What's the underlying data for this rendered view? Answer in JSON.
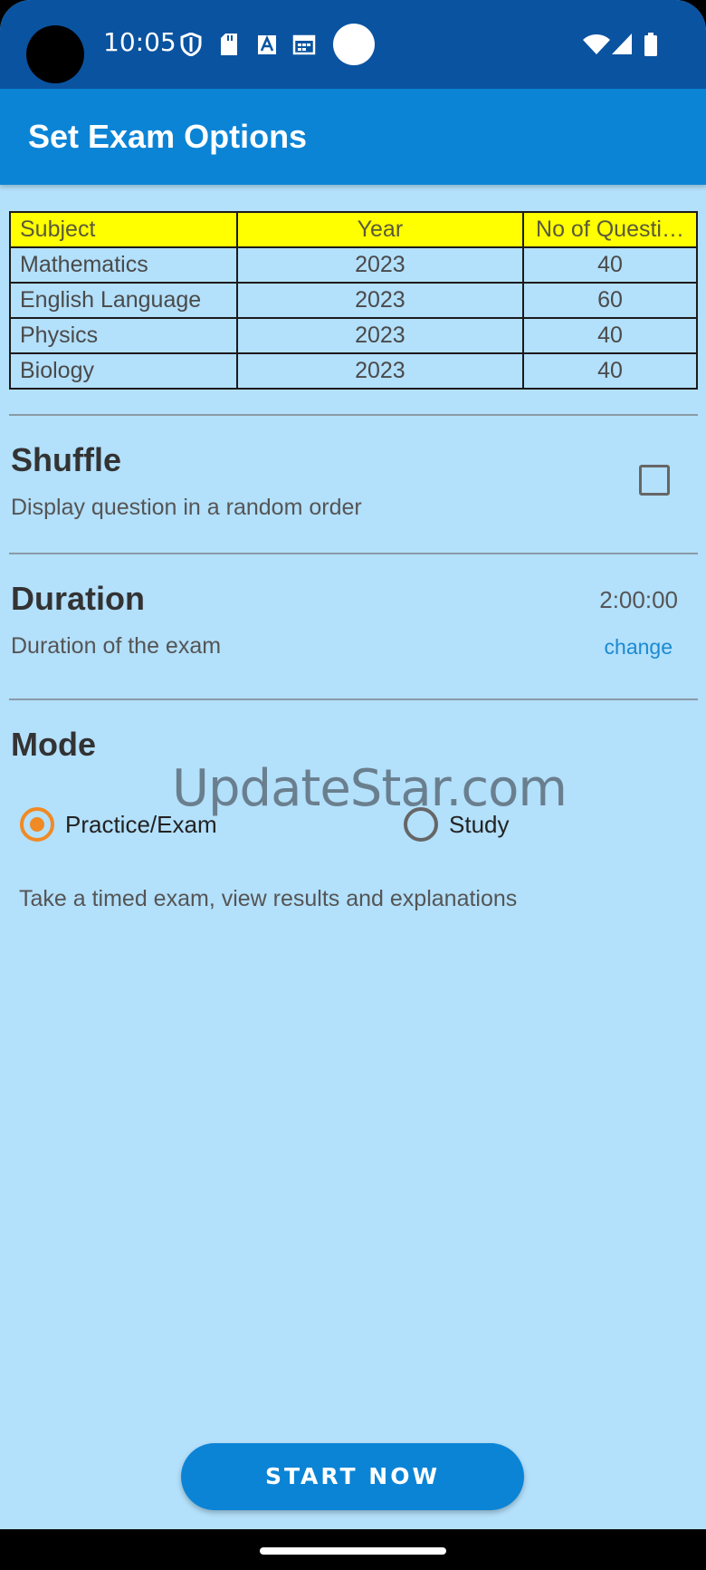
{
  "status_bar": {
    "time": "10:05",
    "left_icons": [
      "shield-icon",
      "sd-card-icon",
      "font-a-icon",
      "calendar-icon"
    ],
    "right_icons": [
      "wifi-icon",
      "signal-icon",
      "battery-icon"
    ]
  },
  "app_bar": {
    "title": "Set Exam Options"
  },
  "table": {
    "headers": [
      "Subject",
      "Year",
      "No of Questi…"
    ],
    "rows": [
      [
        "Mathematics",
        "2023",
        "40"
      ],
      [
        "English Language",
        "2023",
        "60"
      ],
      [
        "Physics",
        "2023",
        "40"
      ],
      [
        "Biology",
        "2023",
        "40"
      ]
    ],
    "header_color": "#ffff00"
  },
  "shuffle": {
    "title": "Shuffle",
    "subtitle": "Display question in a random order",
    "checked": false
  },
  "duration": {
    "title": "Duration",
    "subtitle": "Duration of the exam",
    "value": "2:00:00",
    "change_label": "change"
  },
  "mode": {
    "title": "Mode",
    "options": [
      {
        "label": "Practice/Exam",
        "selected": true
      },
      {
        "label": "Study",
        "selected": false
      }
    ],
    "description": "Take a timed exam, view results and explanations"
  },
  "watermark": "UpdateStar.com",
  "start_button": {
    "label": "START NOW"
  },
  "colors": {
    "status_bar": "#0a53a0",
    "app_bar": "#0b84d6",
    "background": "#b3e0fb",
    "accent": "#f08a24",
    "link": "#1a8ad1"
  }
}
